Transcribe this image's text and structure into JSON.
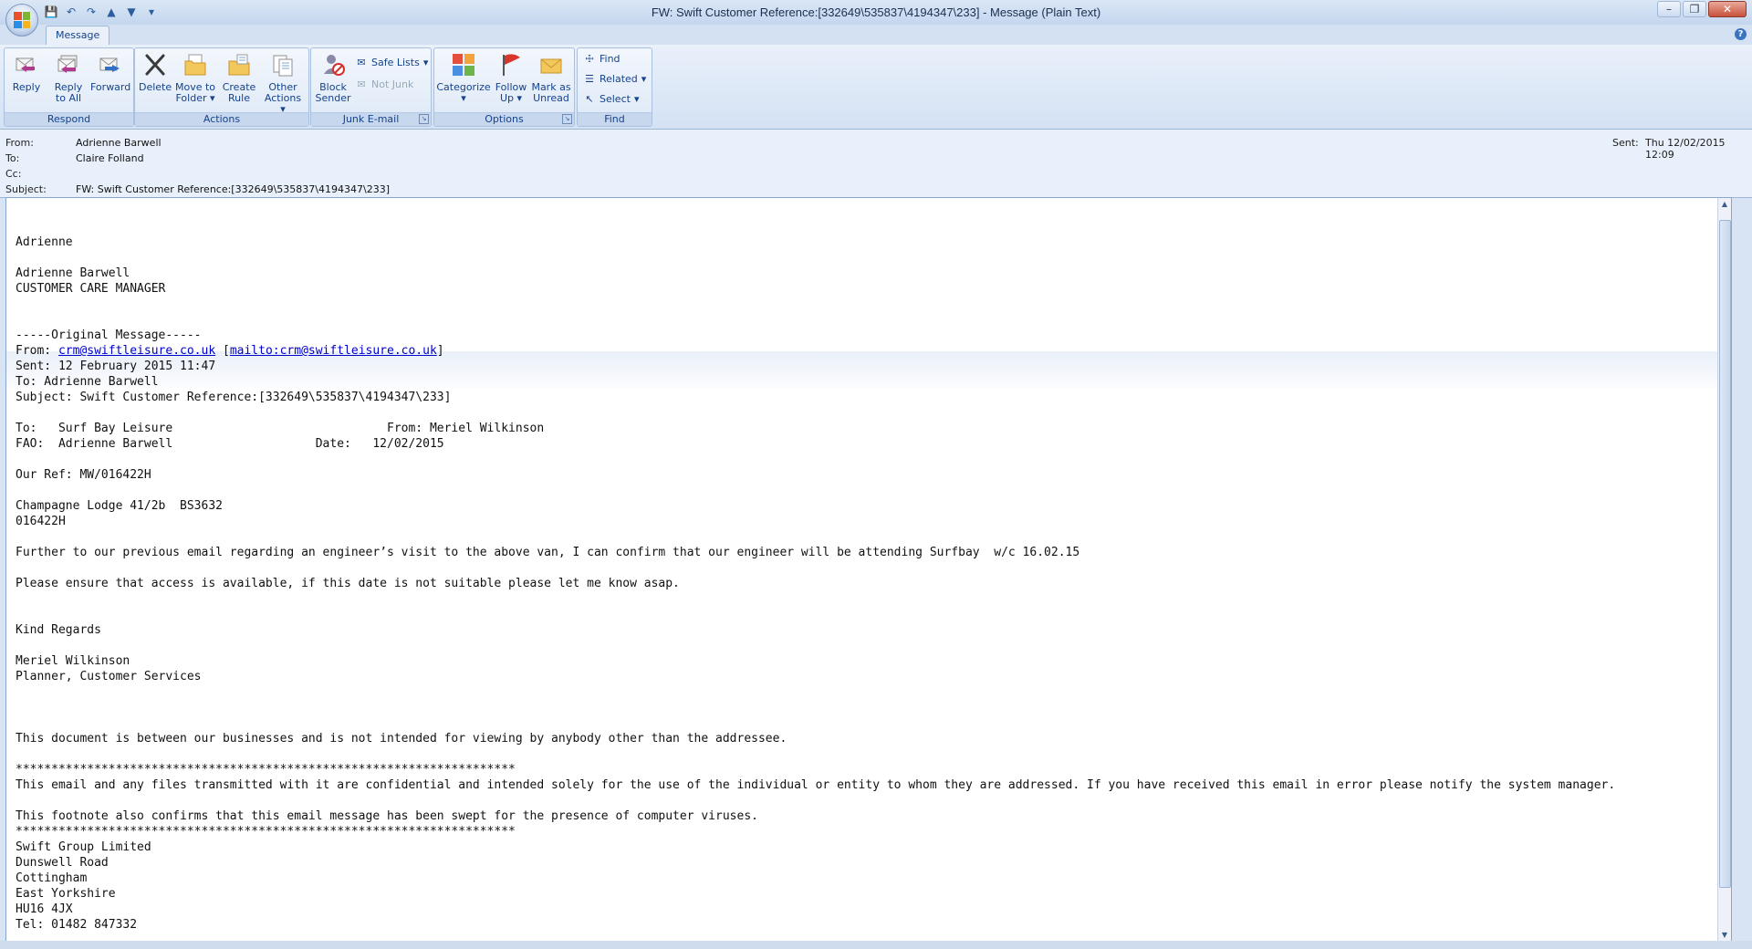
{
  "window": {
    "title": "FW: Swift Customer Reference:[332649\\535837\\4194347\\233] - Message (Plain Text)"
  },
  "tabs": [
    {
      "label": "Message"
    }
  ],
  "ribbon": {
    "respond": {
      "label": "Respond",
      "reply": "Reply",
      "reply_all_1": "Reply",
      "reply_all_2": "to All",
      "forward": "Forward"
    },
    "actions": {
      "label": "Actions",
      "delete": "Delete",
      "move_1": "Move to",
      "move_2": "Folder",
      "create_1": "Create",
      "create_2": "Rule",
      "other_1": "Other",
      "other_2": "Actions"
    },
    "junk": {
      "label": "Junk E-mail",
      "block_1": "Block",
      "block_2": "Sender",
      "safe_lists": "Safe Lists",
      "not_junk": "Not Junk"
    },
    "options": {
      "label": "Options",
      "categorize": "Categorize",
      "follow_1": "Follow",
      "follow_2": "Up",
      "mark_1": "Mark as",
      "mark_2": "Unread"
    },
    "find": {
      "label": "Find",
      "find": "Find",
      "related": "Related",
      "select": "Select"
    }
  },
  "header": {
    "from_label": "From:",
    "from": "Adrienne Barwell",
    "to_label": "To:",
    "to": "Claire Folland",
    "cc_label": "Cc:",
    "cc": "",
    "subject_label": "Subject:",
    "subject": "FW: Swift Customer Reference:[332649\\535837\\4194347\\233]",
    "sent_label": "Sent:",
    "sent": "Thu 12/02/2015 12:09"
  },
  "body": {
    "lines": [
      "",
      "",
      "Adrienne",
      "",
      "Adrienne Barwell",
      "CUSTOMER CARE MANAGER",
      "",
      "",
      "-----Original Message-----",
      "__FROMLINK__",
      "Sent: 12 February 2015 11:47",
      "To: Adrienne Barwell",
      "Subject: Swift Customer Reference:[332649\\535837\\4194347\\233]",
      "",
      "To:   Surf Bay Leisure                              From: Meriel Wilkinson",
      "FAO:  Adrienne Barwell                    Date:   12/02/2015",
      "",
      "Our Ref: MW/016422H",
      "",
      "Champagne Lodge 41/2b  BS3632",
      "016422H",
      "",
      "Further to our previous email regarding an engineer’s visit to the above van, I can confirm that our engineer will be attending Surfbay  w/c 16.02.15",
      "",
      "Please ensure that access is available, if this date is not suitable please let me know asap.",
      "",
      "",
      "Kind Regards",
      "",
      "Meriel Wilkinson",
      "Planner, Customer Services",
      "",
      "",
      "",
      "This document is between our businesses and is not intended for viewing by anybody other than the addressee.",
      "",
      "**********************************************************************",
      "This email and any files transmitted with it are confidential and intended solely for the use of the individual or entity to whom they are addressed. If you have received this email in error please notify the system manager.",
      "",
      "This footnote also confirms that this email message has been swept for the presence of computer viruses.",
      "**********************************************************************",
      "Swift Group Limited",
      "Dunswell Road",
      "Cottingham",
      "East Yorkshire",
      "HU16 4JX",
      "Tel: 01482 847332"
    ],
    "from_prefix": "From: ",
    "from_link": "crm@swiftleisure.co.uk",
    "from_mid": " [",
    "from_mailto": "mailto:crm@swiftleisure.co.uk",
    "from_suffix": "]"
  },
  "colors": {
    "accent": "#15428b",
    "link": "#0000cc"
  }
}
